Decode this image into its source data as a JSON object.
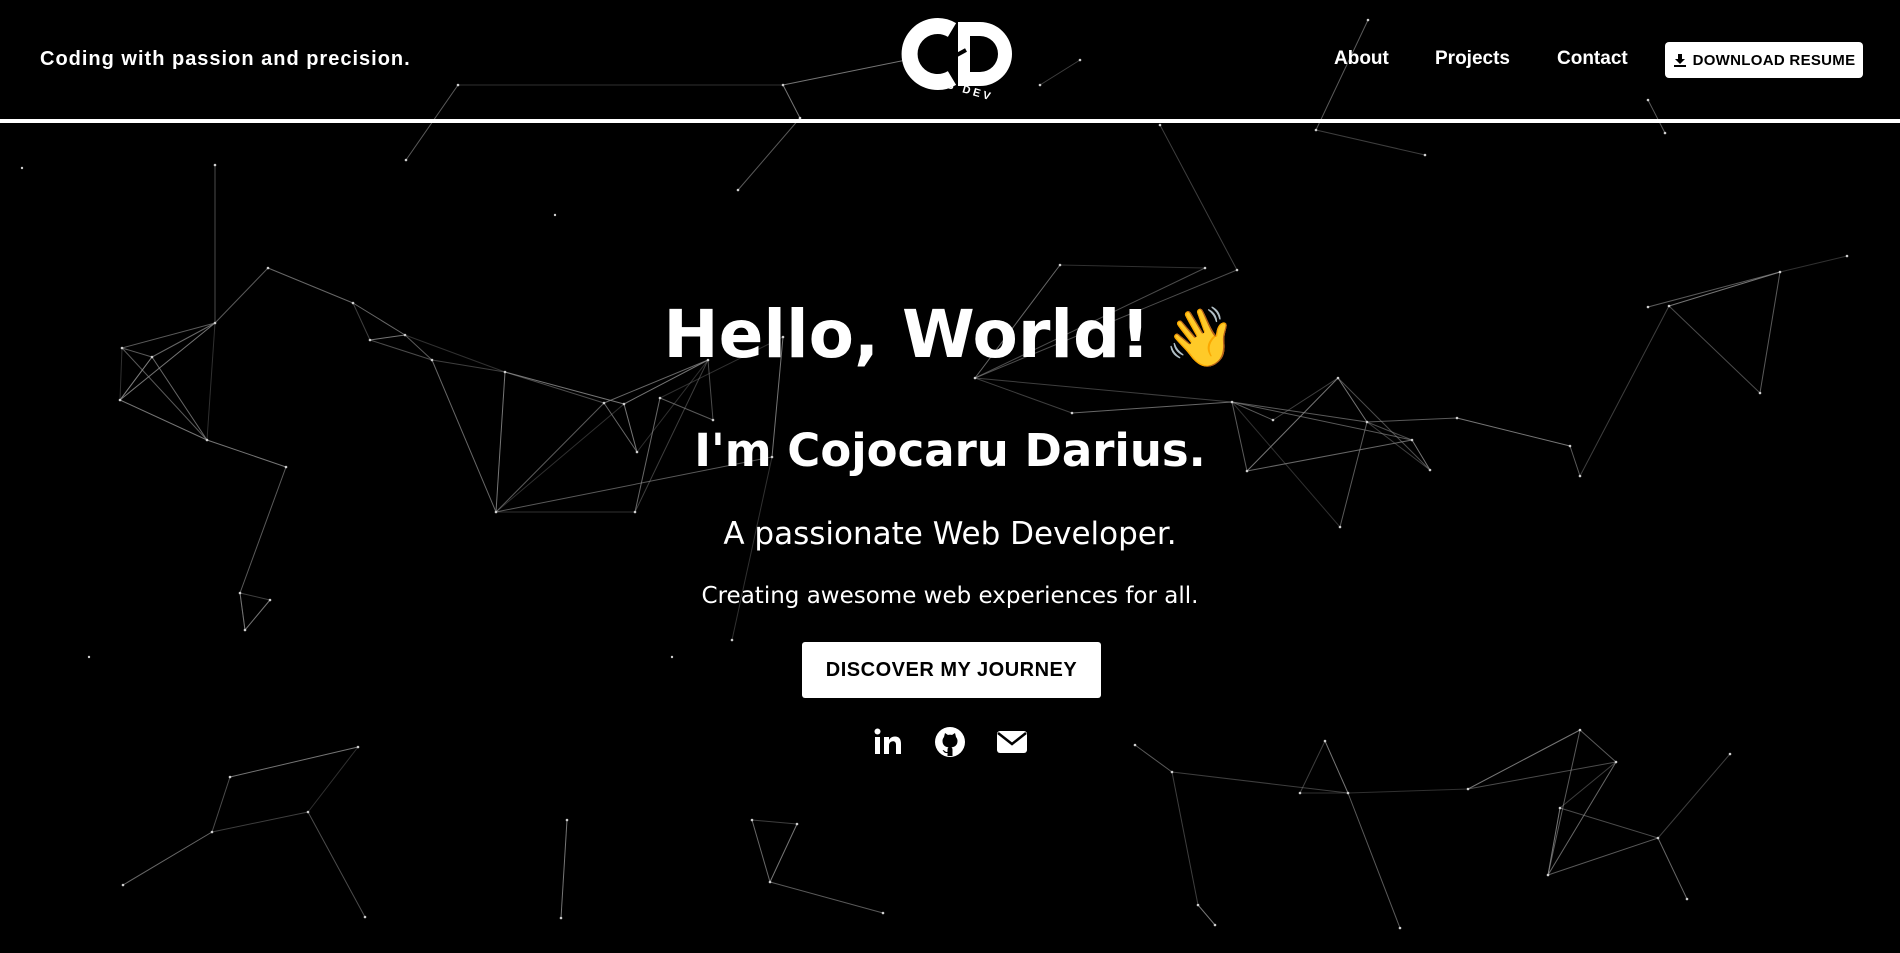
{
  "header": {
    "tagline": "Coding with passion and precision.",
    "logo": {
      "monogram": "CD",
      "caption": "WEB DEV"
    },
    "nav": [
      {
        "label": "About"
      },
      {
        "label": "Projects"
      },
      {
        "label": "Contact"
      }
    ],
    "resume_button": {
      "label": "DOWNLOAD RESUME",
      "icon": "download-icon"
    }
  },
  "hero": {
    "greeting": "Hello, World!",
    "greeting_emoji": "👋",
    "name": "I'm Cojocaru Darius.",
    "role": "A passionate Web Developer.",
    "description": "Creating awesome web experiences for all.",
    "cta_label": "DISCOVER MY JOURNEY"
  },
  "socials": [
    {
      "icon": "linkedin-icon"
    },
    {
      "icon": "github-icon"
    },
    {
      "icon": "envelope-icon"
    }
  ],
  "colors": {
    "background": "#000000",
    "foreground": "#ffffff",
    "network": "#8a8a8a"
  }
}
